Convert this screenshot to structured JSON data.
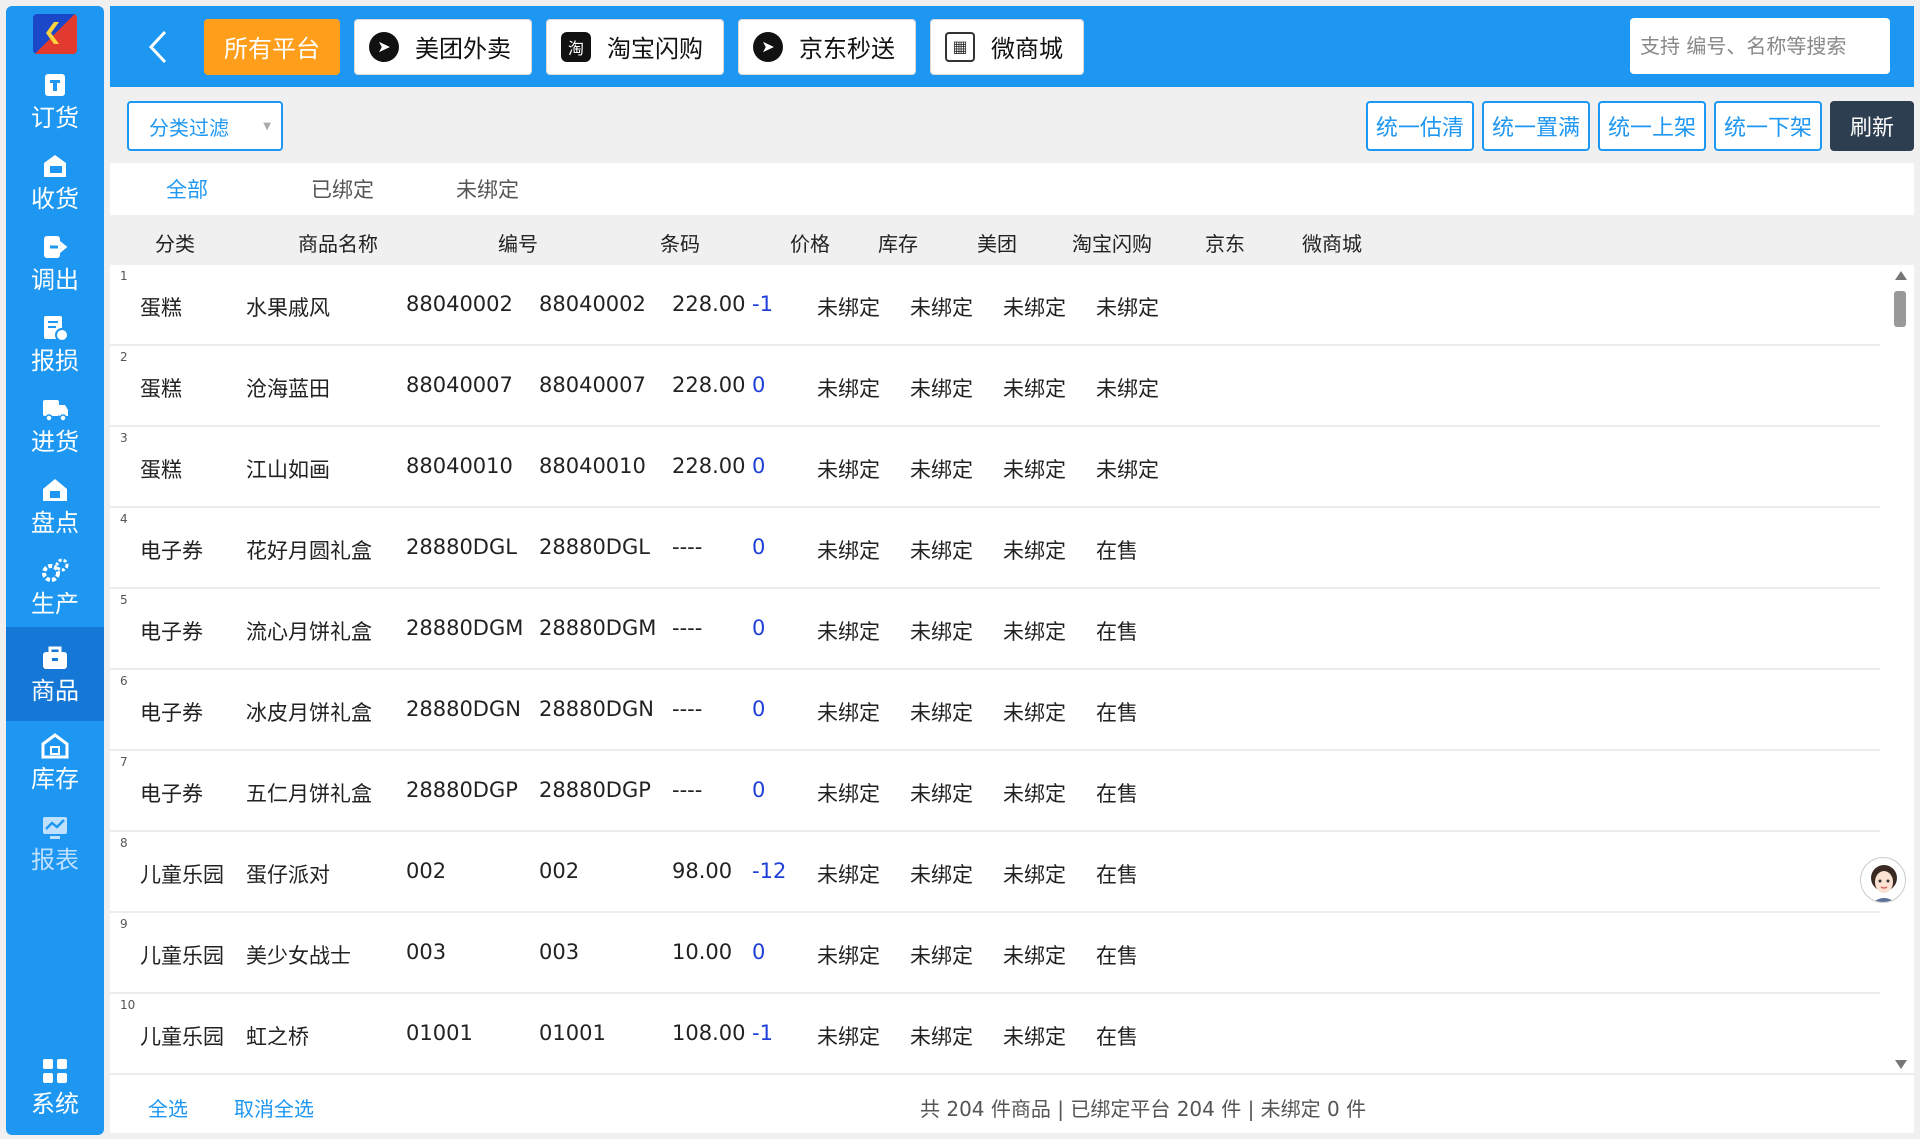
{
  "sidebar": {
    "items": [
      {
        "label": "订货",
        "icon": "order-icon"
      },
      {
        "label": "收货",
        "icon": "receive-icon"
      },
      {
        "label": "调出",
        "icon": "transfer-out-icon"
      },
      {
        "label": "报损",
        "icon": "loss-report-icon"
      },
      {
        "label": "进货",
        "icon": "purchase-icon"
      },
      {
        "label": "盘点",
        "icon": "inventory-check-icon"
      },
      {
        "label": "生产",
        "icon": "production-icon"
      },
      {
        "label": "商品",
        "icon": "goods-icon"
      },
      {
        "label": "库存",
        "icon": "stock-icon"
      },
      {
        "label": "报表",
        "icon": "report-icon"
      }
    ],
    "system_label": "系统"
  },
  "topbar": {
    "all_platforms": "所有平台",
    "platforms": [
      "美团外卖",
      "淘宝闪购",
      "京东秒送",
      "微商城"
    ],
    "search_placeholder": "支持 编号、名称等搜索"
  },
  "filterbar": {
    "category_filter": "分类过滤",
    "actions": [
      "统一估清",
      "统一置满",
      "统一上架",
      "统一下架"
    ],
    "refresh": "刷新"
  },
  "tabs": [
    "全部",
    "已绑定",
    "未绑定"
  ],
  "table": {
    "headers": [
      "分类",
      "商品名称",
      "编号",
      "条码",
      "价格",
      "库存",
      "美团",
      "淘宝闪购",
      "京东",
      "微商城"
    ],
    "rows": [
      {
        "index": "1",
        "category": "蛋糕",
        "name": "水果戚风",
        "code": "88040002",
        "barcode": "88040002",
        "price": "228.00",
        "stock": "-1",
        "meituan": "未绑定",
        "taobao": "未绑定",
        "jd": "未绑定",
        "wshop": "未绑定"
      },
      {
        "index": "2",
        "category": "蛋糕",
        "name": "沧海蓝田",
        "code": "88040007",
        "barcode": "88040007",
        "price": "228.00",
        "stock": "0",
        "meituan": "未绑定",
        "taobao": "未绑定",
        "jd": "未绑定",
        "wshop": "未绑定"
      },
      {
        "index": "3",
        "category": "蛋糕",
        "name": "江山如画",
        "code": "88040010",
        "barcode": "88040010",
        "price": "228.00",
        "stock": "0",
        "meituan": "未绑定",
        "taobao": "未绑定",
        "jd": "未绑定",
        "wshop": "未绑定"
      },
      {
        "index": "4",
        "category": "电子券",
        "name": "花好月圆礼盒",
        "code": "28880DGL",
        "barcode": "28880DGL",
        "price": "----",
        "stock": "0",
        "meituan": "未绑定",
        "taobao": "未绑定",
        "jd": "未绑定",
        "wshop": "在售"
      },
      {
        "index": "5",
        "category": "电子券",
        "name": "流心月饼礼盒",
        "code": "28880DGM",
        "barcode": "28880DGM",
        "price": "----",
        "stock": "0",
        "meituan": "未绑定",
        "taobao": "未绑定",
        "jd": "未绑定",
        "wshop": "在售"
      },
      {
        "index": "6",
        "category": "电子券",
        "name": "冰皮月饼礼盒",
        "code": "28880DGN",
        "barcode": "28880DGN",
        "price": "----",
        "stock": "0",
        "meituan": "未绑定",
        "taobao": "未绑定",
        "jd": "未绑定",
        "wshop": "在售"
      },
      {
        "index": "7",
        "category": "电子券",
        "name": "五仁月饼礼盒",
        "code": "28880DGP",
        "barcode": "28880DGP",
        "price": "----",
        "stock": "0",
        "meituan": "未绑定",
        "taobao": "未绑定",
        "jd": "未绑定",
        "wshop": "在售"
      },
      {
        "index": "8",
        "category": "儿童乐园",
        "name": "蛋仔派对",
        "code": "002",
        "barcode": "002",
        "price": "98.00",
        "stock": "-12",
        "meituan": "未绑定",
        "taobao": "未绑定",
        "jd": "未绑定",
        "wshop": "在售"
      },
      {
        "index": "9",
        "category": "儿童乐园",
        "name": "美少女战士",
        "code": "003",
        "barcode": "003",
        "price": "10.00",
        "stock": "0",
        "meituan": "未绑定",
        "taobao": "未绑定",
        "jd": "未绑定",
        "wshop": "在售"
      },
      {
        "index": "10",
        "category": "儿童乐园",
        "name": "虹之桥",
        "code": "01001",
        "barcode": "01001",
        "price": "108.00",
        "stock": "-1",
        "meituan": "未绑定",
        "taobao": "未绑定",
        "jd": "未绑定",
        "wshop": "在售"
      }
    ]
  },
  "footer": {
    "select_all": "全选",
    "deselect_all": "取消全选",
    "summary": "共 204 件商品 | 已绑定平台 204 件 | 未绑定 0 件"
  },
  "colors": {
    "primary": "#1e97f2",
    "accent": "#ff9e1b",
    "stock": "#1f3fd9",
    "dark": "#2c3e50"
  }
}
